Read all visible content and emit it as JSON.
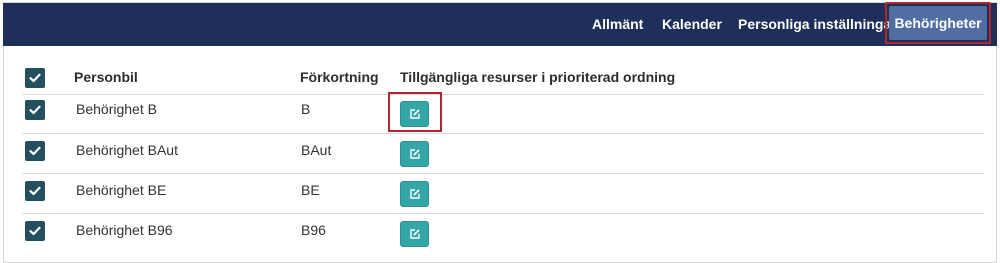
{
  "nav": {
    "items": [
      "Allmänt",
      "Kalender",
      "Personliga inställningar"
    ],
    "active": "Behörigheter"
  },
  "table": {
    "headers": {
      "name": "Personbil",
      "abbreviation": "Förkortning",
      "resources": "Tillgängliga resurser i prioriterad ordning"
    },
    "header_checked": true,
    "rows": [
      {
        "name": "Behörighet B",
        "abbreviation": "B",
        "checked": true,
        "edit_icon": "edit-icon"
      },
      {
        "name": "Behörighet BAut",
        "abbreviation": "BAut",
        "checked": true,
        "edit_icon": "edit-icon"
      },
      {
        "name": "Behörighet BE",
        "abbreviation": "BE",
        "checked": true,
        "edit_icon": "edit-icon"
      },
      {
        "name": "Behörighet B96",
        "abbreviation": "B96",
        "checked": true,
        "edit_icon": "edit-icon"
      }
    ]
  },
  "colors": {
    "nav_background": "#1e3059",
    "nav_active": "#506ea1",
    "highlight_border": "#b3262c",
    "checkbox": "#244f5e",
    "edit_button": "#35a6a8"
  }
}
